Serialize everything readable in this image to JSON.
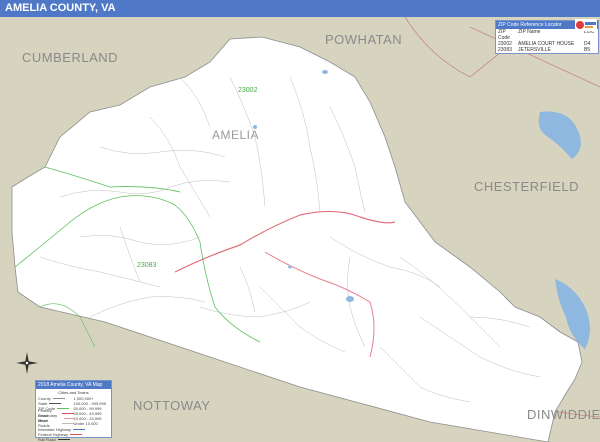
{
  "title": "AMELIA COUNTY, VA",
  "counties": {
    "cumberland": "CUMBERLAND",
    "powhatan": "POWHATAN",
    "chesterfield": "CHESTERFIELD",
    "nottoway": "NOTTOWAY",
    "dinwiddie": "DINWIDDIE",
    "amelia": "AMELIA"
  },
  "zip_labels": {
    "z23002": "23002",
    "z23083": "23083"
  },
  "zip_table": {
    "header": "ZIP Code Reference Locator",
    "columns": [
      "ZIP Code",
      "ZIP Name",
      "LOC"
    ],
    "rows": [
      [
        "23002",
        "AMELIA COURT HOUSE",
        "D4"
      ],
      [
        "23083",
        "JETERSVILLE",
        "B5"
      ]
    ]
  },
  "legend": {
    "title": "2018 Amelia County, VA Map",
    "subtitle": "Cities and Towns",
    "left_rows": [
      "County",
      "State",
      "ZIP Code",
      "Primary Road",
      "Secondary Road",
      "Minor Roads"
    ],
    "right_rows": [
      "1,000,000+",
      "100,000 - 999,999",
      "50,000 - 99,999",
      "25,000 - 49,999",
      "10,000 - 24,999",
      "Under 10,000"
    ],
    "bottom_rows": [
      "Interstate Highway",
      "Federal Highway",
      "Rail Road"
    ]
  },
  "colors": {
    "title_bar": "#4f79c7",
    "outside": "#d6d3bf",
    "county": "#ffffff",
    "water": "#8fb8e0",
    "zip_border": "#5cbf5c",
    "primary_road": "#d94c5c",
    "minor_road": "#bdbdbd"
  },
  "icons": {
    "compass": "compass-rose-icon",
    "logo": "map-publisher-logo"
  }
}
